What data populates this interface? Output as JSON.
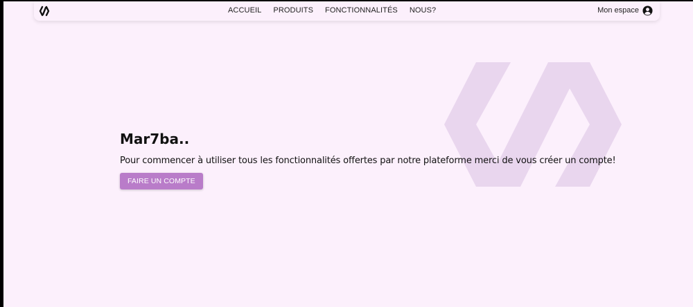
{
  "nav": {
    "logo_icon": "logo-icon",
    "links": [
      {
        "label": "ACCUEIL"
      },
      {
        "label": "PRODUITS"
      },
      {
        "label": "FONCTIONNALITÉS"
      },
      {
        "label": "NOUS?"
      }
    ],
    "account": {
      "label": "Mon espace",
      "icon": "account-circle-icon"
    }
  },
  "hero": {
    "title": "Mar7ba..",
    "text": "Pour commencer à utiliser tous les fonctionnalités offertes par notre plateforme merci de vous créer un compte!",
    "cta_label": "FAIRE UN COMPTE"
  },
  "colors": {
    "background": "#fcf0fc",
    "accent": "#b97cc9",
    "watermark": "#e9d6ee"
  }
}
